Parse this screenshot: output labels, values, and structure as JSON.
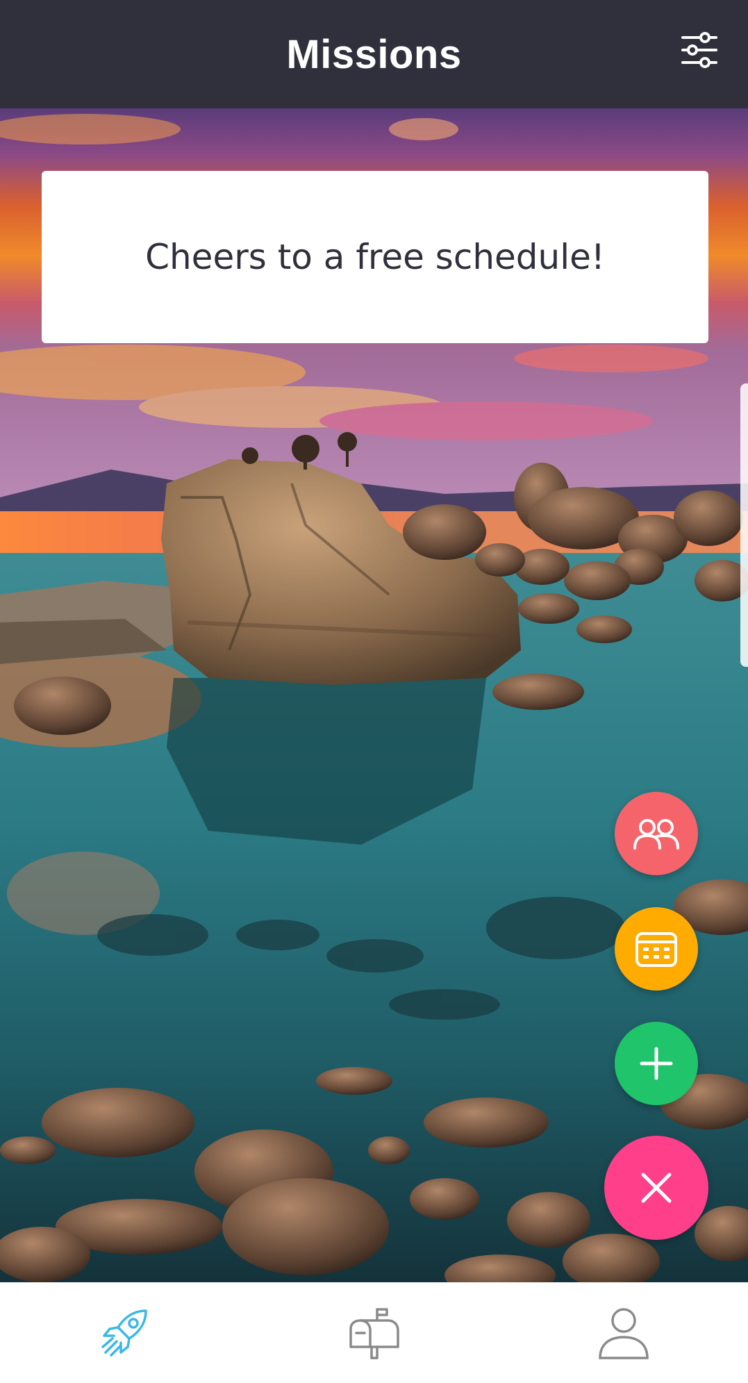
{
  "header": {
    "title": "Missions",
    "filter_icon": "sliders-icon"
  },
  "message_card": {
    "text": "Cheers to a free schedule!"
  },
  "fabs": [
    {
      "name": "team",
      "icon": "team-icon",
      "color": "#f4646a"
    },
    {
      "name": "calendar",
      "icon": "calendar-icon",
      "color": "#ffab00"
    },
    {
      "name": "add",
      "icon": "plus-icon",
      "color": "#1fc46b"
    },
    {
      "name": "close",
      "icon": "close-icon",
      "color": "#ff3f8a"
    }
  ],
  "bottom_nav": {
    "tabs": [
      {
        "name": "missions",
        "icon": "rocket-icon",
        "active": true
      },
      {
        "name": "inbox",
        "icon": "mailbox-icon",
        "active": false
      },
      {
        "name": "profile",
        "icon": "person-icon",
        "active": false
      }
    ]
  },
  "colors": {
    "header_bg": "#2f303b",
    "accent_active": "#3ab8e6",
    "nav_inactive": "#8a8a8a",
    "card_text": "#2f303b"
  }
}
